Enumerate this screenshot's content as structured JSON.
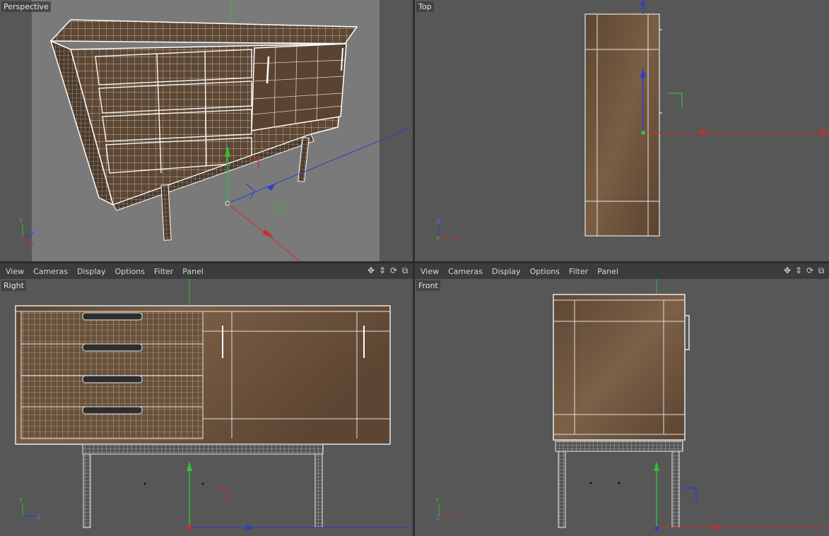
{
  "viewports": {
    "perspective": {
      "label": "Perspective"
    },
    "top": {
      "label": "Top"
    },
    "right": {
      "label": "Right"
    },
    "front": {
      "label": "Front"
    }
  },
  "menu": {
    "view": "View",
    "cameras": "Cameras",
    "display": "Display",
    "options": "Options",
    "filter": "Filter",
    "panel": "Panel"
  },
  "nav_icons": [
    "move-view-icon",
    "dolly-view-icon",
    "rotate-view-icon",
    "maximize-view-icon"
  ],
  "axes": {
    "x": "X",
    "y": "Y",
    "z": "Z"
  },
  "colors": {
    "viewport_bg": "#575757",
    "menubar_bg": "#3c3c3c",
    "axis_x": "#d02a2a",
    "axis_y": "#2fbf3a",
    "axis_z": "#2a3fd0",
    "wood": "#6b5138"
  }
}
